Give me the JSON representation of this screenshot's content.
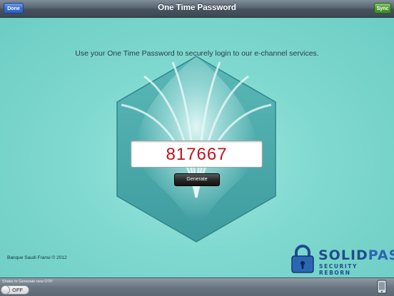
{
  "navbar": {
    "title": "One Time Password",
    "done_label": "Done",
    "sync_label": "Sync"
  },
  "main": {
    "instruction": "Use your One Time Password to securely login to our e-channel services.",
    "otp_value": "817667",
    "generate_label": "Generate",
    "copyright": "Banque Saudi Fransi © 2012"
  },
  "brand": {
    "name_part1": "SOLID",
    "name_part2": "PASS",
    "tagline": "SECURITY REBORN"
  },
  "bottombar": {
    "shake_label": "Shake to Generate new OTP",
    "toggle_state": "OFF"
  },
  "icons": {
    "logo": "bsf-hexagon-logo-icon",
    "lock": "padlock-icon",
    "device": "iphone-device-icon"
  },
  "colors": {
    "background": "#7fd8cf",
    "otp_text": "#c0121c",
    "done_button": "#3a6fd8",
    "sync_button": "#4f9c35",
    "brand": "#1f4d8a"
  }
}
